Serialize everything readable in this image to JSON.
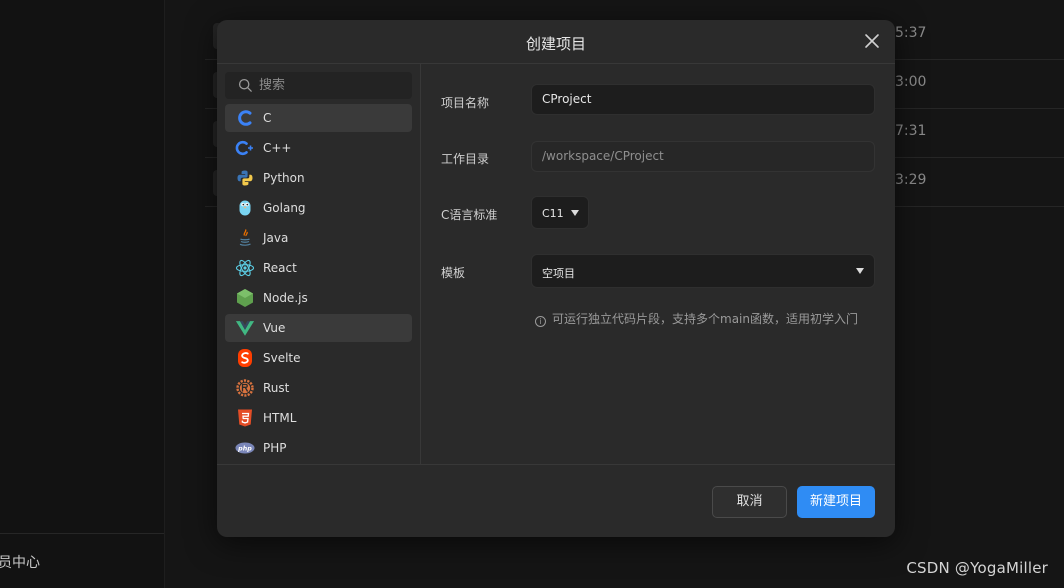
{
  "background": {
    "sidebar_bottom_label": "员中心",
    "row_times": [
      "5:37",
      "3:00",
      "7:31",
      "3:29"
    ],
    "watermark": "CSDN @YogaMiller"
  },
  "dialog": {
    "title": "创建项目",
    "search_placeholder": "搜索",
    "languages": [
      {
        "label": "C",
        "icon": "c-language-icon",
        "state": "selected"
      },
      {
        "label": "C++",
        "icon": "cpp-icon",
        "state": ""
      },
      {
        "label": "Python",
        "icon": "python-icon",
        "state": ""
      },
      {
        "label": "Golang",
        "icon": "golang-icon",
        "state": ""
      },
      {
        "label": "Java",
        "icon": "java-icon",
        "state": ""
      },
      {
        "label": "React",
        "icon": "react-icon",
        "state": ""
      },
      {
        "label": "Node.js",
        "icon": "nodejs-icon",
        "state": ""
      },
      {
        "label": "Vue",
        "icon": "vue-icon",
        "state": "hovered"
      },
      {
        "label": "Svelte",
        "icon": "svelte-icon",
        "state": ""
      },
      {
        "label": "Rust",
        "icon": "rust-icon",
        "state": ""
      },
      {
        "label": "HTML",
        "icon": "html5-icon",
        "state": ""
      },
      {
        "label": "PHP",
        "icon": "php-icon",
        "state": ""
      }
    ],
    "form": {
      "name_label": "项目名称",
      "name_value": "CProject",
      "dir_label": "工作目录",
      "dir_value": "/workspace/CProject",
      "std_label": "C语言标准",
      "std_value": "C11",
      "template_label": "模板",
      "template_value": "空项目",
      "hint": "可运行独立代码片段，支持多个main函数，适用初学入门"
    },
    "cancel_label": "取消",
    "create_label": "新建项目"
  },
  "colors": {
    "accent": "#2f8cf4",
    "dialog_bg": "#2a2a2a",
    "page_bg": "#141414"
  }
}
